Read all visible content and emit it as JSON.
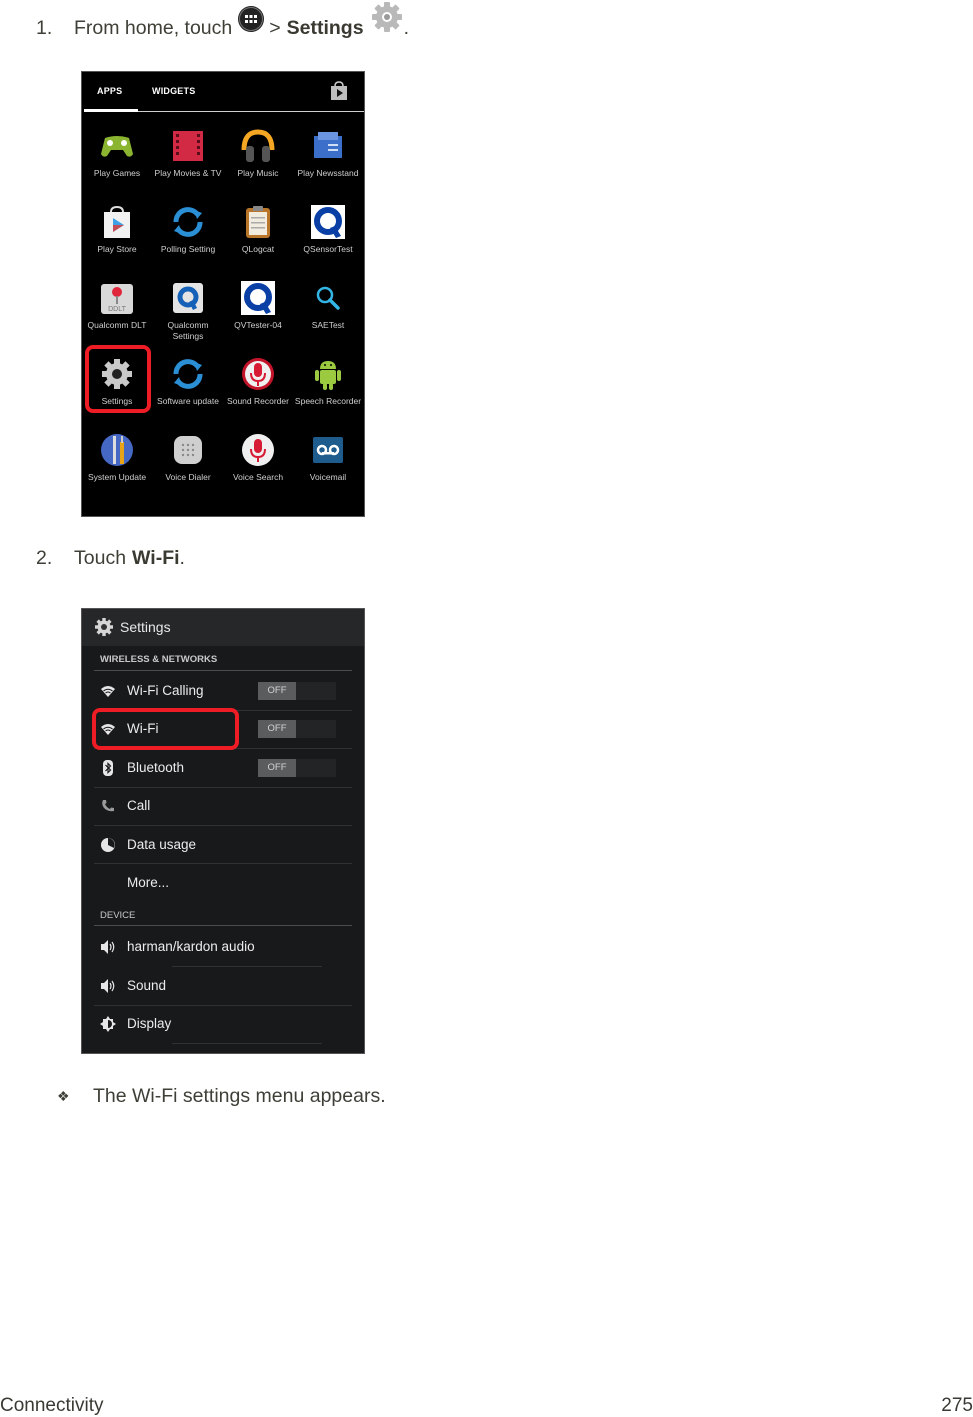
{
  "steps": [
    {
      "number": "1.",
      "text_before": "From home, touch",
      "apps_icon": "apps-launcher-icon",
      "separator": ">",
      "bold_target": "Settings",
      "settings_icon": "settings-gear-icon",
      "text_after": "."
    },
    {
      "number": "2.",
      "text_before": "Touch",
      "bold_target": "Wi-Fi",
      "text_after": "."
    }
  ],
  "app_drawer": {
    "tabs": [
      {
        "label": "APPS",
        "active": true
      },
      {
        "label": "WIDGETS",
        "active": false
      }
    ],
    "store_icon": "play-store-bag-icon",
    "apps": [
      {
        "label": "Play Games",
        "icon": "play-games-icon"
      },
      {
        "label": "Play Movies & TV",
        "icon": "play-movies-icon"
      },
      {
        "label": "Play Music",
        "icon": "play-music-icon"
      },
      {
        "label": "Play Newsstand",
        "icon": "play-newsstand-icon"
      },
      {
        "label": "Play Store",
        "icon": "play-store-icon"
      },
      {
        "label": "Polling Setting",
        "icon": "polling-setting-icon"
      },
      {
        "label": "QLogcat",
        "icon": "qlogcat-icon"
      },
      {
        "label": "QSensorTest",
        "icon": "qsensortest-icon"
      },
      {
        "label": "Qualcomm DLT",
        "icon": "qualcomm-dlt-icon"
      },
      {
        "label": "Qualcomm Settings",
        "icon": "qualcomm-settings-icon"
      },
      {
        "label": "QVTester-04",
        "icon": "qvtester-icon"
      },
      {
        "label": "SAETest",
        "icon": "saetest-search-icon"
      },
      {
        "label": "Settings",
        "icon": "settings-gear-icon",
        "highlighted": true
      },
      {
        "label": "Software update",
        "icon": "software-update-icon"
      },
      {
        "label": "Sound Recorder",
        "icon": "sound-recorder-icon"
      },
      {
        "label": "Speech Recorder",
        "icon": "android-robot-icon"
      },
      {
        "label": "System Update",
        "icon": "system-update-icon"
      },
      {
        "label": "Voice Dialer",
        "icon": "voice-dialer-icon"
      },
      {
        "label": "Voice Search",
        "icon": "voice-search-icon"
      },
      {
        "label": "Voicemail",
        "icon": "voicemail-icon"
      }
    ]
  },
  "settings_screen": {
    "title": "Settings",
    "sections": [
      {
        "header": "WIRELESS & NETWORKS",
        "items": [
          {
            "label": "Wi-Fi Calling",
            "icon": "wifi-icon",
            "toggle": "OFF"
          },
          {
            "label": "Wi-Fi",
            "icon": "wifi-icon",
            "toggle": "OFF",
            "highlighted": true
          },
          {
            "label": "Bluetooth",
            "icon": "bluetooth-icon",
            "toggle": "OFF"
          },
          {
            "label": "Call",
            "icon": "phone-icon"
          },
          {
            "label": "Data usage",
            "icon": "data-usage-icon"
          },
          {
            "label": "More...",
            "icon": ""
          }
        ]
      },
      {
        "header": "DEVICE",
        "items": [
          {
            "label": "harman/kardon audio",
            "icon": "speaker-icon"
          },
          {
            "label": "Sound",
            "icon": "speaker-icon"
          },
          {
            "label": "Display",
            "icon": "display-brightness-icon"
          }
        ]
      }
    ]
  },
  "result": {
    "bullet": "❖",
    "text": "The Wi-Fi settings menu appears."
  },
  "footer": {
    "section": "Connectivity",
    "page": "275"
  },
  "colors": {
    "highlight": "#ee1c24",
    "body_text": "#3f3f38"
  }
}
